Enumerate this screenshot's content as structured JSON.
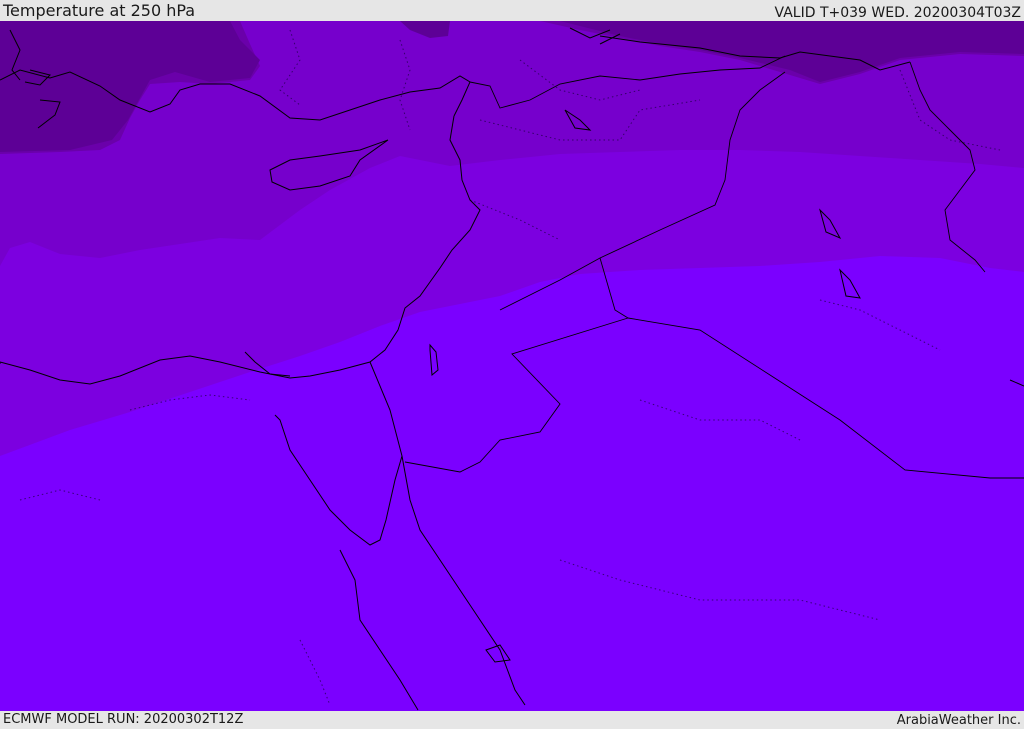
{
  "header": {
    "title": "Temperature at 250 hPa",
    "valid": "VALID T+039 WED. 20200304T03Z"
  },
  "footer": {
    "model_run": "ECMWF MODEL RUN: 20200302T12Z",
    "credit": "ArabiaWeather Inc."
  },
  "map": {
    "region": "Eastern Mediterranean and Middle East",
    "field": "250 hPa temperature",
    "colors": {
      "coldest": "#5c0094",
      "cold": "#6a00aa",
      "mid": "#7a00c6",
      "warm": "#7c00e0",
      "warmest": "#7b00ff",
      "coastline": "#000000"
    }
  }
}
